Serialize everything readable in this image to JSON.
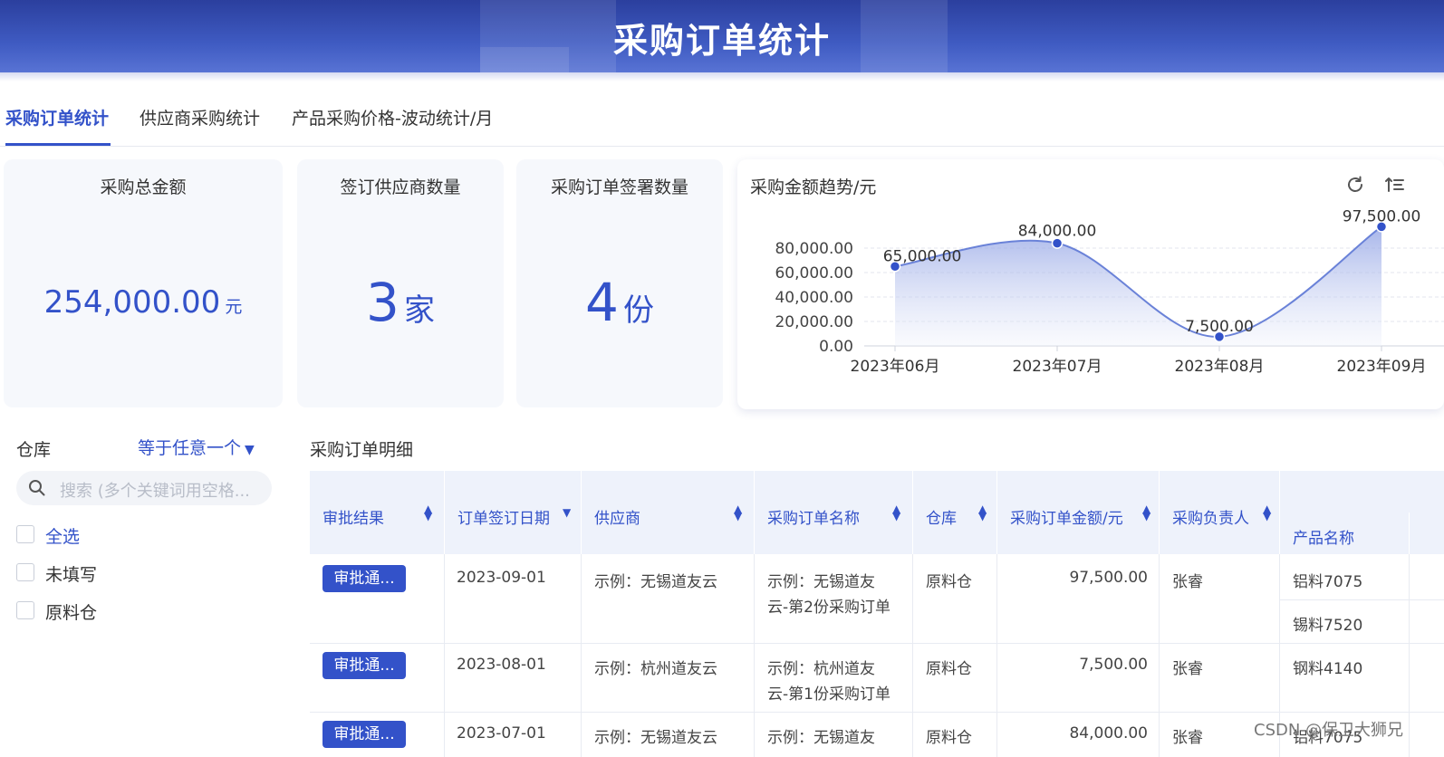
{
  "banner": {
    "title": "采购订单统计"
  },
  "tabs": [
    {
      "label": "采购订单统计",
      "active": true
    },
    {
      "label": "供应商采购统计",
      "active": false
    },
    {
      "label": "产品采购价格-波动统计/月",
      "active": false
    }
  ],
  "kpis": {
    "total_amount": {
      "title": "采购总金额",
      "value": "254,000.00",
      "unit": "元"
    },
    "suppliers": {
      "title": "签订供应商数量",
      "value": "3",
      "unit": "家"
    },
    "orders": {
      "title": "采购订单签署数量",
      "value": "4",
      "unit": "份"
    }
  },
  "chart": {
    "title": "采购金额趋势/元",
    "refresh_icon": "refresh-icon",
    "sort_icon": "sort-icon"
  },
  "chart_data": {
    "type": "area",
    "title": "采购金额趋势/元",
    "categories": [
      "2023年06月",
      "2023年07月",
      "2023年08月",
      "2023年09月"
    ],
    "series": [
      {
        "values": [
          65000,
          84000,
          7500,
          97500
        ],
        "labels": [
          "65,000.00",
          "84,000.00",
          "7,500.00",
          "97,500.00"
        ]
      }
    ],
    "yticks": [
      "0.00",
      "20,000.00",
      "40,000.00",
      "60,000.00",
      "80,000.00"
    ],
    "ylim": [
      0,
      80000
    ],
    "grid": true,
    "colors": {
      "line": "#6a82d8",
      "fill_top": "#8a9de3",
      "fill_bottom": "#eef1fb",
      "point": "#3352c9"
    }
  },
  "filter": {
    "label": "仓库",
    "mode": "等于任意一个",
    "search_placeholder": "搜索 (多个关键词用空格...",
    "options": [
      {
        "label": "全选",
        "checked": false
      },
      {
        "label": "未填写",
        "checked": false
      },
      {
        "label": "原料仓",
        "checked": false
      }
    ]
  },
  "table": {
    "title": "采购订单明细",
    "headers": [
      "审批结果",
      "订单签订日期",
      "供应商",
      "采购订单名称",
      "仓库",
      "采购订单金额/元",
      "采购负责人",
      "产品名称"
    ],
    "rows": [
      {
        "status": "审批通...",
        "date": "2023-09-01",
        "supplier": "示例：无锡道友云",
        "name_line1": "示例：无锡道友",
        "name_line2": "云-第2份采购订单",
        "warehouse": "原料仓",
        "amount": "97,500.00",
        "owner": "张睿",
        "products": [
          "铝料7075",
          "锡料7520"
        ]
      },
      {
        "status": "审批通...",
        "date": "2023-08-01",
        "supplier": "示例：杭州道友云",
        "name_line1": "示例：杭州道友",
        "name_line2": "云-第1份采购订单",
        "warehouse": "原料仓",
        "amount": "7,500.00",
        "owner": "张睿",
        "products": [
          "钢料4140"
        ]
      },
      {
        "status": "审批通...",
        "date": "2023-07-01",
        "supplier": "示例：无锡道友云",
        "name_line1": "示例：无锡道友",
        "name_line2": "",
        "warehouse": "原料仓",
        "amount": "84,000.00",
        "owner": "张睿",
        "products": [
          "铝料7075"
        ]
      }
    ]
  },
  "watermark": "CSDN @保卫大狮兄"
}
